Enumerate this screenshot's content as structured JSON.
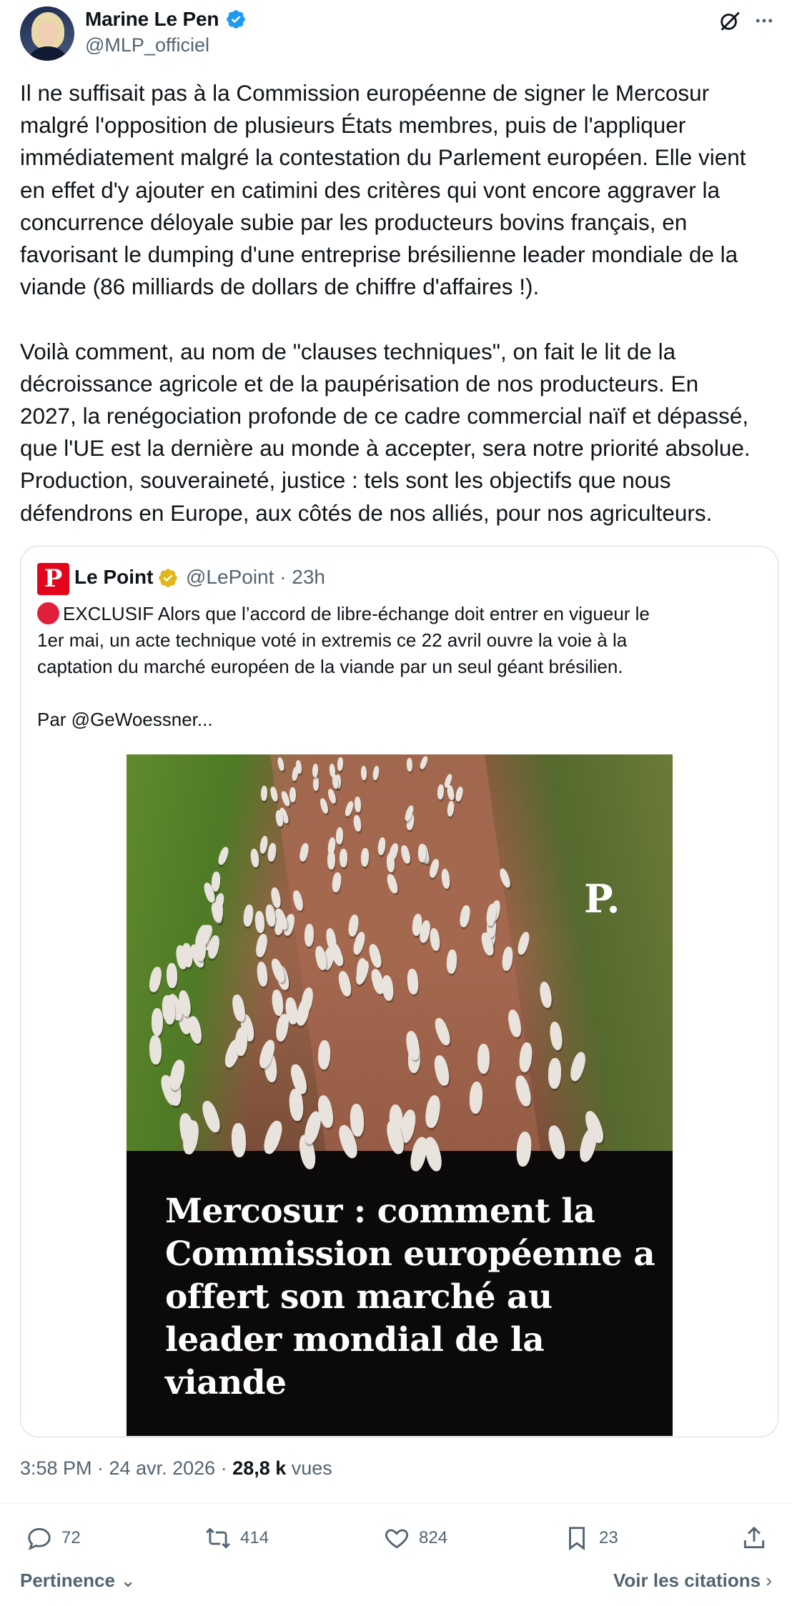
{
  "author": {
    "name": "Marine Le Pen",
    "handle": "@MLP_officiel"
  },
  "tweet": {
    "text": "Il ne suffisait pas à la Commission européenne de signer le Mercosur\nmalgré l'opposition de plusieurs États membres, puis de l'appliquer\nimmédiatement malgré la contestation du Parlement européen. Elle vient\nen effet d'y ajouter en catimini des critères qui vont encore aggraver la\nconcurrence déloyale subie par les producteurs bovins français, en\nfavorisant le dumping d'une entreprise brésilienne leader mondiale de la\nviande (86 milliards de dollars de chiffre d'affaires !).\n\nVoilà comment, au nom de \"clauses techniques\", on fait le lit de la\ndécroissance agricole et de la paupérisation de nos producteurs. En\n2027, la renégociation profonde de ce cadre commercial naïf et dépassé,\nque l'UE est la dernière au monde à accepter, sera notre priorité absolue.\nProduction, souveraineté, justice : tels sont les objectifs que nous\ndéfendrons en Europe, aux côtés de nos alliés, pour nos agriculteurs."
  },
  "quote": {
    "logo_letter": "P",
    "name": "Le Point",
    "handle": "@LePoint · 23h",
    "text_line1": "EXCLUSIF Alors que l’accord de libre-échange doit entrer en vigueur le",
    "text_rest": "1er mai, un acte technique voté in extremis ce 22 avril ouvre la voie à la\ncaptation du marché européen de la viande par un seul géant brésilien.\n\nPar @GeWoessner...",
    "media": {
      "watermark": "P.",
      "headline": "Mercosur : comment la Commission européenne a offert son marché au leader mondial de la viande"
    }
  },
  "meta": {
    "time_date": "3:58 PM · 24 avr. 2026 · ",
    "views_count": "28,8 k",
    "views_label": " vues"
  },
  "actions": {
    "replies": "72",
    "retweets": "414",
    "likes": "824",
    "bookmarks": "23"
  },
  "footer": {
    "sort_label": "Pertinence",
    "quotes_link": "Voir les citations"
  },
  "colors": {
    "verified": "#1d9bf0",
    "gold_verified": "#e2b719",
    "le_point_red": "#e3051b",
    "muted_text": "#536471"
  }
}
